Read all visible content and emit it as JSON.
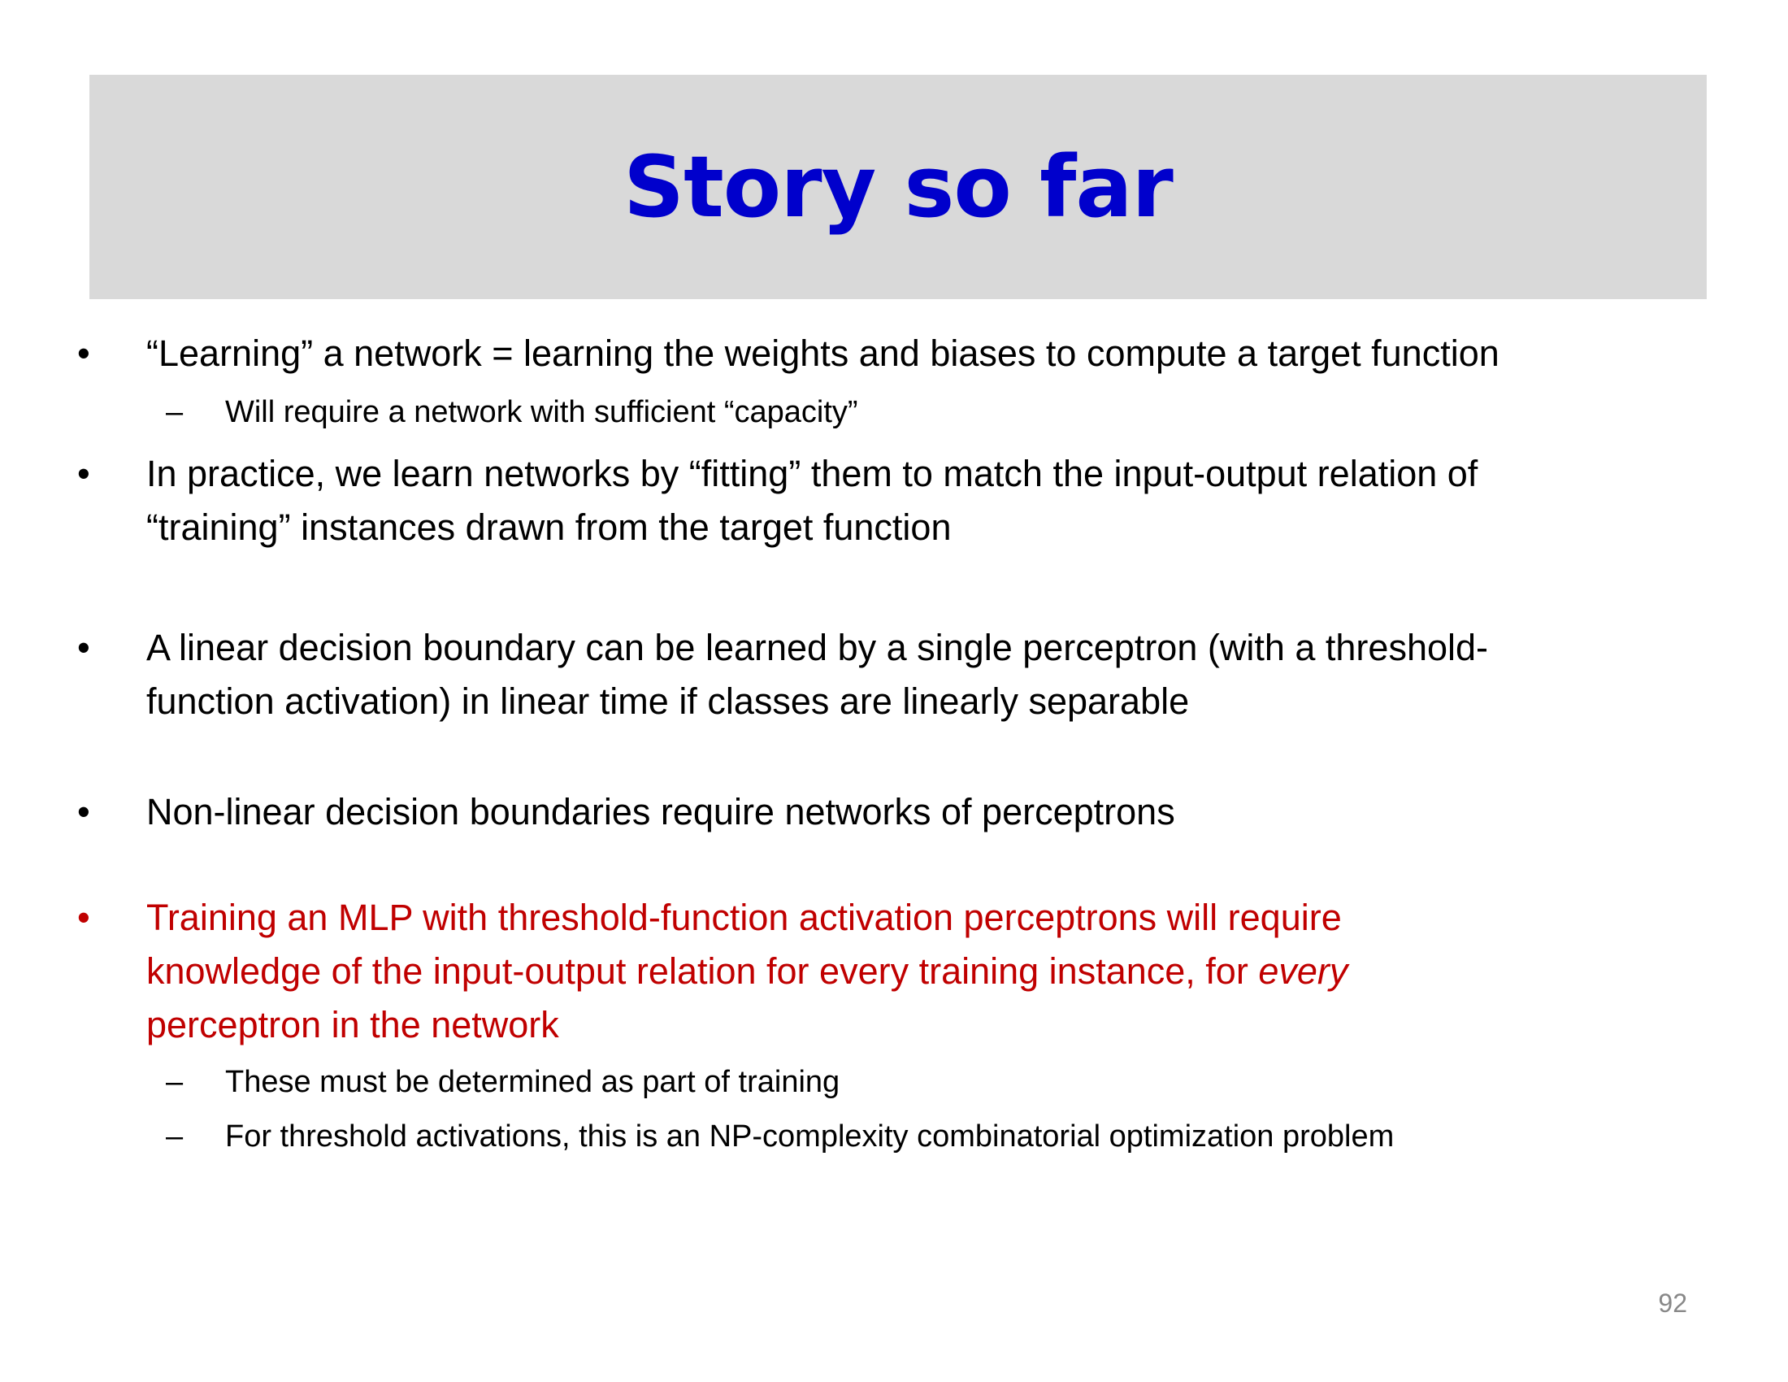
{
  "slide": {
    "title": "Story so far",
    "page_number": "92",
    "colors": {
      "title": "#0000cc",
      "title_band": "#d9d9d9",
      "highlight": "#c00000",
      "text": "#000000"
    },
    "bullet_glyph": "•",
    "dash_glyph": "–",
    "bullets": [
      {
        "text": "“Learning” a network = learning the weights and biases to compute a target function",
        "subs": [
          "Will require a network with sufficient “capacity”"
        ]
      },
      {
        "line1": "In practice, we learn networks by “fitting” them to match the input-output relation of",
        "line2": "“training” instances drawn from the target function"
      },
      {
        "line1": "A linear decision boundary can be learned by a single perceptron (with a threshold-",
        "line2": "function activation) in linear time if classes are linearly separable"
      },
      {
        "text": "Non-linear decision boundaries require networks of perceptrons"
      },
      {
        "line1": "Training an MLP with threshold-function activation perceptrons will require",
        "line2_pre": "knowledge of the input-output relation for every training instance, for ",
        "line2_em": "every",
        "line3": "perceptron in the network",
        "subs": [
          "These must be determined as part of training",
          "For threshold activations,  this is an NP-complexity combinatorial optimization problem"
        ]
      }
    ]
  }
}
